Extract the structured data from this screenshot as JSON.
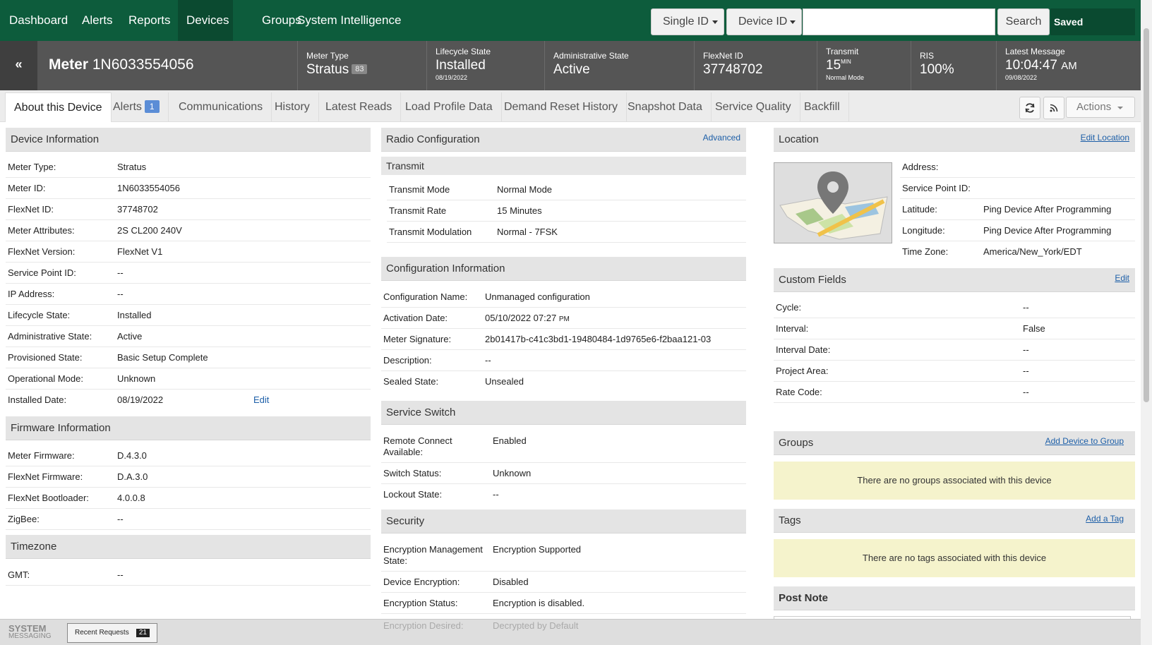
{
  "nav": {
    "items": [
      "Dashboard",
      "Alerts",
      "Reports",
      "Devices",
      "Groups",
      "System Intelligence"
    ],
    "active": "Devices",
    "search_type": "Single ID",
    "search_field": "Device ID",
    "search_value": "",
    "search_label": "Search",
    "saved_label": "Saved"
  },
  "device": {
    "collapse_label": "«",
    "title_prefix": "Meter",
    "title_id": "1N6033554056",
    "meter_type_label": "Meter Type",
    "meter_type": "Stratus",
    "meter_type_count": "83",
    "lifecycle_label": "Lifecycle State",
    "lifecycle": "Installed",
    "lifecycle_date": "08/19/2022",
    "admin_label": "Administrative State",
    "admin": "Active",
    "flexnet_label": "FlexNet ID",
    "flexnet": "37748702",
    "transmit_label": "Transmit",
    "transmit_value": "15",
    "transmit_unit": "MIN",
    "transmit_mode": "Normal Mode",
    "ris_label": "RIS",
    "ris": "100%",
    "latest_label": "Latest Message",
    "latest_time": "10:04:47",
    "latest_ampm": "AM",
    "latest_date": "09/08/2022"
  },
  "tabs": [
    {
      "label": "About this Device"
    },
    {
      "label": "Alerts",
      "count": "1"
    },
    {
      "label": "Communications"
    },
    {
      "label": "History"
    },
    {
      "label": "Latest Reads"
    },
    {
      "label": "Load Profile Data"
    },
    {
      "label": "Demand Reset History"
    },
    {
      "label": "Snapshot Data"
    },
    {
      "label": "Service Quality"
    },
    {
      "label": "Backfill"
    }
  ],
  "actions_label": "Actions",
  "device_info": {
    "title": "Device Information",
    "edit_label": "Edit",
    "rows": [
      [
        "Meter Type:",
        "Stratus"
      ],
      [
        "Meter ID:",
        "1N6033554056"
      ],
      [
        "FlexNet ID:",
        "37748702"
      ],
      [
        "Meter Attributes:",
        "2S CL200 240V"
      ],
      [
        "FlexNet Version:",
        "FlexNet V1"
      ],
      [
        "Service Point ID:",
        "--"
      ],
      [
        "IP Address:",
        "--"
      ],
      [
        "Lifecycle State:",
        "Installed"
      ],
      [
        "Administrative State:",
        "Active"
      ],
      [
        "Provisioned State:",
        "Basic Setup Complete"
      ],
      [
        "Operational Mode:",
        "Unknown"
      ],
      [
        "Installed Date:",
        "08/19/2022"
      ]
    ]
  },
  "firmware": {
    "title": "Firmware Information",
    "rows": [
      [
        "Meter Firmware:",
        "D.4.3.0"
      ],
      [
        "FlexNet Firmware:",
        "D.A.3.0"
      ],
      [
        "FlexNet Bootloader:",
        "4.0.0.8"
      ],
      [
        "ZigBee:",
        "--"
      ]
    ]
  },
  "timezone": {
    "title": "Timezone",
    "rows": [
      [
        "GMT:",
        "--"
      ]
    ]
  },
  "radio": {
    "title": "Radio Configuration",
    "link": "Advanced",
    "transmit_title": "Transmit",
    "rows": [
      [
        "Transmit Mode",
        "Normal Mode"
      ],
      [
        "Transmit Rate",
        "15 Minutes"
      ],
      [
        "Transmit Modulation",
        "Normal - 7FSK"
      ]
    ]
  },
  "config": {
    "title": "Configuration Information",
    "rows": [
      [
        "Configuration Name:",
        "Unmanaged configuration"
      ],
      [
        "Activation Date:",
        "05/10/2022 07:27",
        "PM"
      ],
      [
        "Meter Signature:",
        "2b01417b-c41c3bd1-19480484-1d9765e6-f2baa121-03"
      ],
      [
        "Description:",
        "--"
      ],
      [
        "Sealed State:",
        "Unsealed"
      ]
    ]
  },
  "switch": {
    "title": "Service Switch",
    "rows": [
      [
        "Remote Connect Available:",
        "Enabled"
      ],
      [
        "Switch Status:",
        "Unknown"
      ],
      [
        "Lockout State:",
        "--"
      ]
    ]
  },
  "security": {
    "title": "Security",
    "rows": [
      [
        "Encryption Management State:",
        "Encryption Supported"
      ],
      [
        "Device Encryption:",
        "Disabled"
      ],
      [
        "Encryption Status:",
        "Encryption is disabled."
      ],
      [
        "Encryption Desired:",
        "Decrypted by Default"
      ]
    ]
  },
  "location": {
    "title": "Location",
    "link": "Edit Location",
    "rows": [
      [
        "Address:",
        ""
      ],
      [
        "Service Point ID:",
        ""
      ],
      [
        "Latitude:",
        "Ping Device After Programming"
      ],
      [
        "Longitude:",
        "Ping Device After Programming"
      ],
      [
        "Time Zone:",
        "America/New_York/EDT"
      ]
    ]
  },
  "custom": {
    "title": "Custom Fields",
    "link": "Edit",
    "rows": [
      [
        "Cycle:",
        "--"
      ],
      [
        "Interval:",
        "False"
      ],
      [
        "Interval Date:",
        "--"
      ],
      [
        "Project Area:",
        "--"
      ],
      [
        "Rate Code:",
        "--"
      ]
    ]
  },
  "groups": {
    "title": "Groups",
    "link": "Add Device to Group",
    "empty": "There are no groups associated with this device"
  },
  "tags": {
    "title": "Tags",
    "link": "Add a Tag",
    "empty": "There are no tags associated with this device"
  },
  "post_note": {
    "title": "Post Note"
  },
  "bottom": {
    "sys_line1": "SYSTEM",
    "sys_line2": "MESSAGING",
    "recent_label": "Recent Requests",
    "recent_count": "21"
  },
  "colors": {
    "nav": "#0d5c3c",
    "header": "#555555",
    "link": "#1d5fa8",
    "notice": "#f5f3cc"
  }
}
